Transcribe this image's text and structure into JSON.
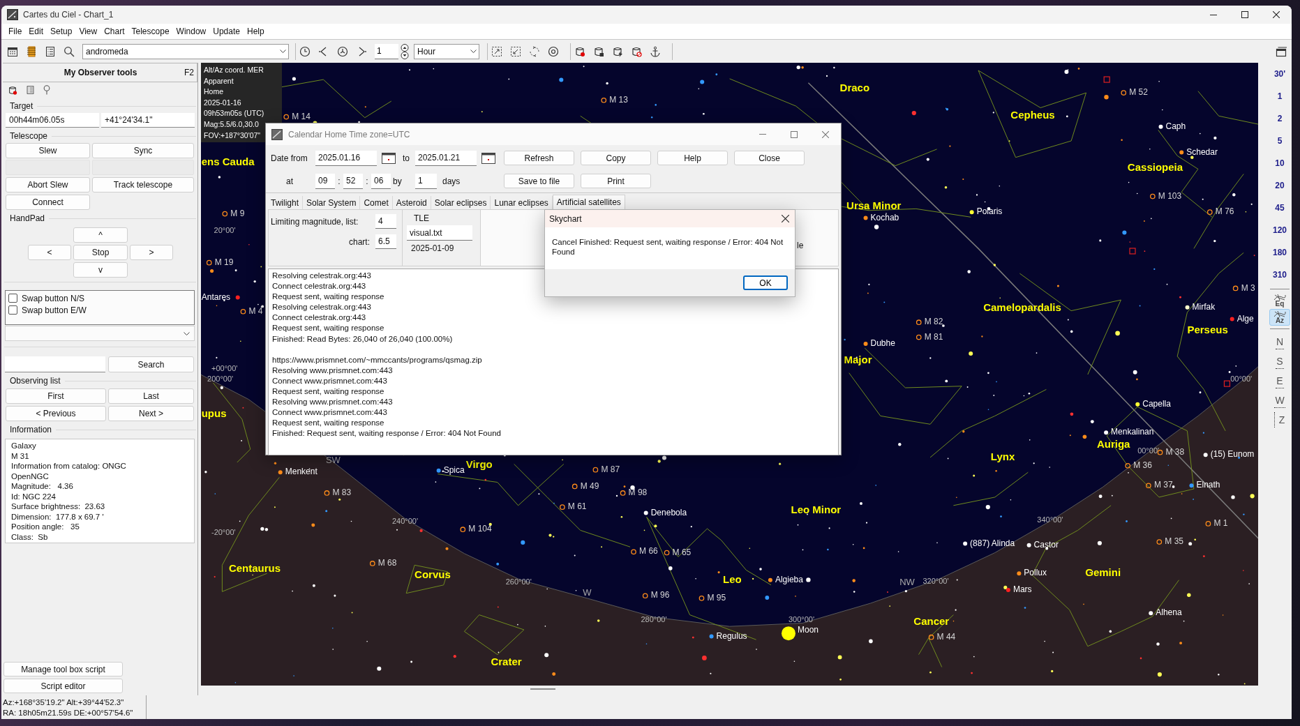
{
  "window": {
    "title": "Cartes du Ciel - Chart_1"
  },
  "menu": [
    "File",
    "Edit",
    "Setup",
    "View",
    "Chart",
    "Telescope",
    "Window",
    "Update",
    "Help"
  ],
  "toolbar": {
    "search": "andromeda",
    "step": "1",
    "step_unit": "Hour"
  },
  "tool_panel": {
    "title": "My Observer tools",
    "shortcut": "F2",
    "target": {
      "label": "Target",
      "ra": "00h44m06.05s",
      "dec": "+41°24'34.1\""
    },
    "telescope": {
      "label": "Telescope",
      "buttons": [
        "Slew",
        "Sync",
        "Abort Slew",
        "Track telescope",
        "Connect"
      ]
    },
    "handpad": {
      "label": "HandPad",
      "up": "^",
      "left": "<",
      "stop": "Stop",
      "right": ">",
      "down": "v"
    },
    "options": [
      {
        "label": "Swap button N/S",
        "checked": false
      },
      {
        "label": "Swap button E/W",
        "checked": false
      }
    ],
    "search_button": "Search",
    "observing_list": {
      "label": "Observing list",
      "buttons": [
        "First",
        "Last",
        "< Previous",
        "Next >"
      ]
    },
    "information": {
      "label": "Information",
      "lines": [
        "Galaxy",
        "M 31",
        "Information from catalog: ONGC",
        "OpenNGC",
        "Magnitude:   4.36",
        "Id: NGC 224",
        "Surface brightness:  23.63",
        "Dimension:  177.8 x 69.7 '",
        "Position angle:   35",
        "Class:  Sb"
      ]
    },
    "script_buttons": [
      "Manage tool box script",
      "Script editor"
    ]
  },
  "status_bar": {
    "lines": [
      "Az:+168°35'19.2\" Alt:+39°44'52.3\"",
      "RA: 18h05m21.59s DE:+00°57'54.6\""
    ]
  },
  "sky_chart": {
    "info": [
      "Alt/Az coord. MER",
      "Apparent",
      "Home",
      "2025-01-16",
      "09h53m05s (UTC)",
      "Mag:5.5/6.0,30.0",
      "FOV:+187°30'07\""
    ],
    "labels": [
      {
        "kind": "constellation",
        "text": "Draco"
      },
      {
        "kind": "constellation",
        "text": "Cepheus"
      },
      {
        "kind": "constellation",
        "text": "Cassiopeia"
      },
      {
        "kind": "constellation",
        "text": "Ursa Minor"
      },
      {
        "kind": "constellation",
        "text": "Camelopardalis"
      },
      {
        "kind": "constellation",
        "text": "Perseus"
      },
      {
        "kind": "constellation",
        "text": "Auriga"
      },
      {
        "kind": "constellation",
        "text": "Lynx"
      },
      {
        "kind": "constellation",
        "text": "Gemini"
      },
      {
        "kind": "constellation",
        "text": "Cancer"
      },
      {
        "kind": "constellation",
        "text": "Leo"
      },
      {
        "kind": "constellation",
        "text": "Leo Minor"
      },
      {
        "kind": "constellation",
        "text": "Corvus"
      },
      {
        "kind": "constellation",
        "text": "Crater"
      },
      {
        "kind": "constellation",
        "text": "Centaurus"
      },
      {
        "kind": "constellation",
        "text": "Virgo"
      },
      {
        "kind": "constellation",
        "text": "Major"
      },
      {
        "kind": "constellation",
        "text": "ens Cauda"
      },
      {
        "kind": "constellation",
        "text": "upus"
      },
      {
        "kind": "star",
        "text": "Caph",
        "color": "#ffffff"
      },
      {
        "kind": "star",
        "text": "Schedar",
        "color": "#ff8c1a"
      },
      {
        "kind": "star",
        "text": "Polaris",
        "color": "#ffff33"
      },
      {
        "kind": "star",
        "text": "Kochab",
        "color": "#ff8c1a"
      },
      {
        "kind": "star",
        "text": "Mirfak",
        "color": "#ffffcc"
      },
      {
        "kind": "star",
        "text": "Alge",
        "color": "#ff2020"
      },
      {
        "kind": "star",
        "text": "Dubhe",
        "color": "#ff8c1a"
      },
      {
        "kind": "star",
        "text": "Capella",
        "color": "#ffff33"
      },
      {
        "kind": "star",
        "text": "Menkalinan",
        "color": "#ffffff"
      },
      {
        "kind": "star",
        "text": "Elnath",
        "color": "#3399ff"
      },
      {
        "kind": "star",
        "text": "(15) Eunom",
        "color": "#ffffff"
      },
      {
        "kind": "star",
        "text": "(887) Alinda",
        "color": "#ffffff"
      },
      {
        "kind": "star",
        "text": "Castor",
        "color": "#ffffff"
      },
      {
        "kind": "star",
        "text": "Pollux",
        "color": "#ff8c1a"
      },
      {
        "kind": "star",
        "text": "Mars",
        "color": "#ff2020"
      },
      {
        "kind": "star",
        "text": "Alhena",
        "color": "#ffffff"
      },
      {
        "kind": "star",
        "text": "Algieba",
        "color": "#ff8c1a"
      },
      {
        "kind": "star",
        "text": "Regulus",
        "color": "#3399ff"
      },
      {
        "kind": "body",
        "text": "Moon",
        "color": "#ffff00"
      },
      {
        "kind": "star",
        "text": "Denebola",
        "color": "#ffffff"
      },
      {
        "kind": "star",
        "text": "Menkent",
        "color": "#ff8c1a"
      },
      {
        "kind": "star",
        "text": "Spica",
        "color": "#3399ff"
      },
      {
        "kind": "star",
        "text": "Antares",
        "color": "#ff2020"
      },
      {
        "kind": "messier",
        "text": "M 14"
      },
      {
        "kind": "messier",
        "text": "M 13"
      },
      {
        "kind": "messier",
        "text": "M 52"
      },
      {
        "kind": "messier",
        "text": "M 103"
      },
      {
        "kind": "messier",
        "text": "M 76"
      },
      {
        "kind": "messier",
        "text": "M 82"
      },
      {
        "kind": "messier",
        "text": "M 81"
      },
      {
        "kind": "messier",
        "text": "M 38"
      },
      {
        "kind": "messier",
        "text": "M 36"
      },
      {
        "kind": "messier",
        "text": "M 37"
      },
      {
        "kind": "messier",
        "text": "M 35"
      },
      {
        "kind": "messier",
        "text": "M 44"
      },
      {
        "kind": "messier",
        "text": "M 87"
      },
      {
        "kind": "messier",
        "text": "M 49"
      },
      {
        "kind": "messier",
        "text": "M 98"
      },
      {
        "kind": "messier",
        "text": "M 61"
      },
      {
        "kind": "messier",
        "text": "M 66"
      },
      {
        "kind": "messier",
        "text": "M 65"
      },
      {
        "kind": "messier",
        "text": "M 96"
      },
      {
        "kind": "messier",
        "text": "M 95"
      },
      {
        "kind": "messier",
        "text": "M 104"
      },
      {
        "kind": "messier",
        "text": "M 83"
      },
      {
        "kind": "messier",
        "text": "M 68"
      },
      {
        "kind": "messier",
        "text": "M 19"
      },
      {
        "kind": "messier",
        "text": "M 9"
      },
      {
        "kind": "messier",
        "text": "M 4"
      },
      {
        "kind": "messier",
        "text": "M 3"
      },
      {
        "kind": "messier",
        "text": "M 1"
      },
      {
        "kind": "grid",
        "text": "20°00'"
      },
      {
        "kind": "grid",
        "text": "+00°00'"
      },
      {
        "kind": "grid",
        "text": "200°00'"
      },
      {
        "kind": "grid",
        "text": "-20°00'"
      },
      {
        "kind": "grid",
        "text": "240°00'"
      },
      {
        "kind": "grid",
        "text": "260°00'"
      },
      {
        "kind": "grid",
        "text": "280°00'"
      },
      {
        "kind": "grid",
        "text": "300°00'"
      },
      {
        "kind": "grid",
        "text": "320°00'"
      },
      {
        "kind": "grid",
        "text": "340°00'"
      },
      {
        "kind": "grid",
        "text": "00°00'"
      },
      {
        "kind": "grid",
        "text": "00°00'"
      },
      {
        "kind": "cardinal",
        "text": "SW"
      },
      {
        "kind": "cardinal",
        "text": "W"
      },
      {
        "kind": "cardinal",
        "text": "NW"
      }
    ]
  },
  "zoom_bar": {
    "fov": [
      "30'",
      "1",
      "2",
      "5",
      "10",
      "20",
      "45",
      "120",
      "180",
      "310"
    ],
    "grid_modes": [
      {
        "label": "Eq",
        "selected": false
      },
      {
        "label": "Az",
        "selected": true
      }
    ],
    "directions": [
      "N",
      "S",
      "E",
      "W",
      "Z"
    ]
  },
  "calendar_dialog": {
    "title": "Calendar Home Time zone=UTC",
    "date_from_label": "Date from",
    "date_from": "2025.01.16",
    "to_label": "to",
    "date_to": "2025.01.21",
    "at_label": "at",
    "hour": "09",
    "minute": "52",
    "second": "06",
    "time_separators": [
      ":",
      ":"
    ],
    "by_label": "by",
    "step": "1",
    "days_label": "days",
    "buttons": [
      "Refresh",
      "Copy",
      "Help",
      "Close",
      "Save to file",
      "Print"
    ],
    "tabs": [
      {
        "label": "Twilight",
        "selected": false
      },
      {
        "label": "Solar System",
        "selected": false
      },
      {
        "label": "Comet",
        "selected": false
      },
      {
        "label": "Asteroid",
        "selected": false
      },
      {
        "label": "Solar eclipses",
        "selected": false
      },
      {
        "label": "Lunar eclipses",
        "selected": false
      },
      {
        "label": "Artificial satellites",
        "selected": true
      }
    ],
    "satellites": {
      "limit_label": "Limiting magnitude, list:",
      "limit_list": "4",
      "chart_label": "chart:",
      "limit_chart": "6.5",
      "tle_label": "TLE",
      "tle_file": "visual.txt",
      "tle_date": "2025-01-09",
      "fragment": "le"
    },
    "log": [
      [
        "Resolving celestrak.org:443",
        "Connect celestrak.org:443",
        "Request sent, waiting response",
        "Resolving celestrak.org:443",
        "Connect celestrak.org:443",
        "Request sent, waiting response",
        "Finished: Read Bytes: 26,040 of 26,040 (100.00%)"
      ],
      [
        "https://www.prismnet.com/~mmccants/programs/qsmag.zip",
        "Resolving www.prismnet.com:443",
        "Connect www.prismnet.com:443",
        "Request sent, waiting response",
        "Resolving www.prismnet.com:443",
        "Connect www.prismnet.com:443",
        "Request sent, waiting response",
        "Finished: Request sent, waiting response / Error: 404 Not Found"
      ]
    ]
  },
  "message_box": {
    "title": "Skychart",
    "text": "Cancel Finished: Request sent, waiting response / Error: 404 Not Found",
    "button": "OK"
  }
}
